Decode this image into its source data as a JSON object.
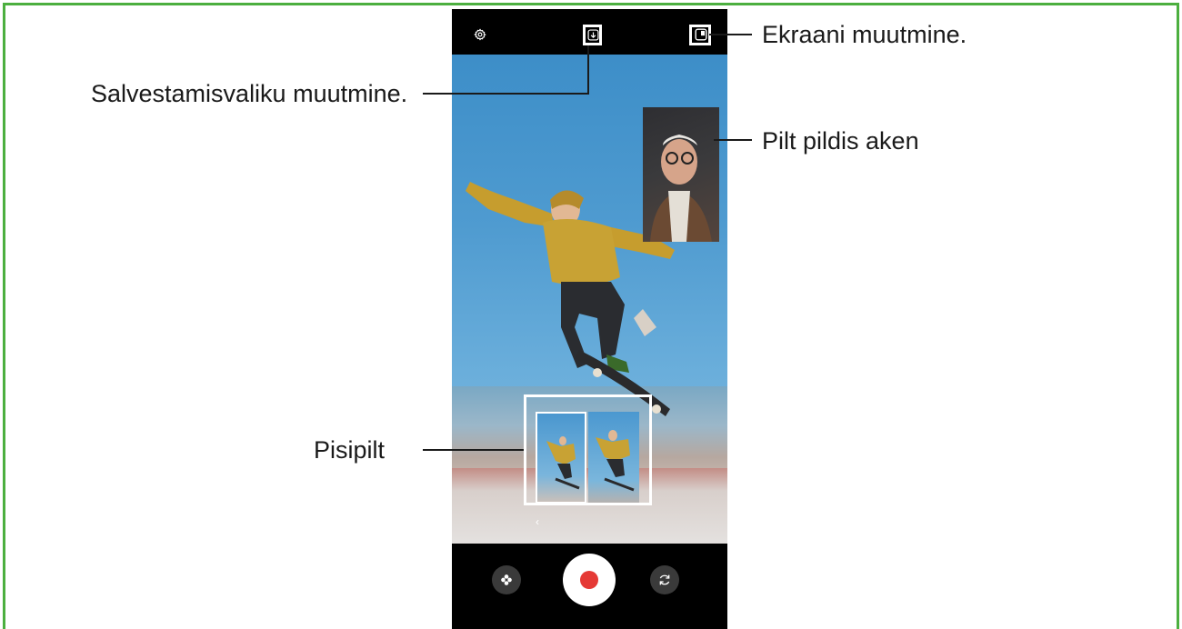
{
  "callouts": {
    "screen_change": "Ekraani muutmine.",
    "save_option": "Salvestamisvaliku muutmine.",
    "pip_window": "Pilt pildis aken",
    "thumbnail": "Pisipilt"
  },
  "icons": {
    "settings": "gear-icon",
    "save_option": "download-icon",
    "screen_layout": "split-screen-icon",
    "effects": "effects-flower-icon",
    "record": "record-icon",
    "switch_camera": "switch-camera-icon",
    "expand": "chevron-left-icon"
  },
  "colors": {
    "frame_border": "#4caf3f",
    "record_dot": "#e53935",
    "callout_text": "#1a1a1a"
  }
}
